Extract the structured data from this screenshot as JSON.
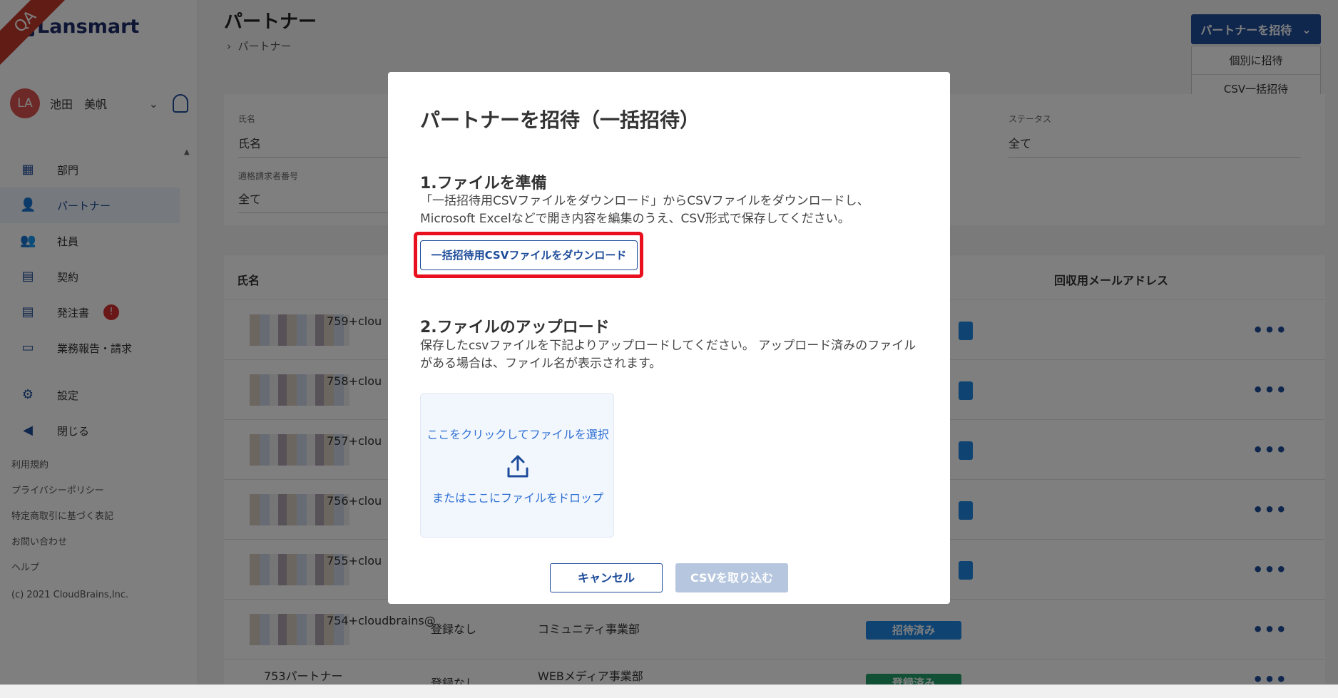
{
  "app": {
    "logo_text": "Lansmart",
    "qa_ribbon": "QA"
  },
  "user": {
    "initials": "LA",
    "name": "池田　美帆"
  },
  "sidebar": {
    "items": [
      {
        "label": "部門",
        "icon": "building-icon"
      },
      {
        "label": "パートナー",
        "icon": "person-icon"
      },
      {
        "label": "社員",
        "icon": "people-icon"
      },
      {
        "label": "契約",
        "icon": "document-icon"
      },
      {
        "label": "発注書",
        "icon": "document-icon",
        "badge": "!"
      },
      {
        "label": "業務報告・請求",
        "icon": "folder-icon"
      },
      {
        "label": "設定",
        "icon": "gear-icon"
      },
      {
        "label": "閉じる",
        "icon": "collapse-icon"
      }
    ],
    "footer_links": [
      "利用規約",
      "プライバシーポリシー",
      "特定商取引に基づく表記",
      "お問い合わせ",
      "ヘルプ"
    ],
    "copyright": "(c) 2021 CloudBrains,Inc."
  },
  "header": {
    "title": "パートナー",
    "breadcrumb": "パートナー",
    "invite_button": "パートナーを招待",
    "invite_menu": [
      "個別に招待",
      "CSV一括招待"
    ]
  },
  "filters": {
    "name_label": "氏名",
    "name_placeholder": "氏名",
    "invoice_label": "適格請求者番号",
    "invoice_value": "全て",
    "status_label": "ステータス",
    "status_value": "全て"
  },
  "table": {
    "headers": {
      "name": "氏名",
      "recovery_email": "回収用メールアドレス"
    },
    "rows": [
      {
        "email": "759+clou",
        "status": "",
        "dept": "",
        "phone": ""
      },
      {
        "email": "758+clou",
        "status": "",
        "dept": "",
        "phone": ""
      },
      {
        "email": "757+clou",
        "status": "",
        "dept": "",
        "phone": ""
      },
      {
        "email": "756+clou",
        "status": "",
        "dept": "",
        "phone": ""
      },
      {
        "email": "755+clou",
        "status": "",
        "dept": "",
        "phone": ""
      },
      {
        "email": "754+cloudbrains@",
        "phone": "登録なし",
        "dept": "コミュニティ事業部",
        "status": "招待済み"
      },
      {
        "email": "753パートナー",
        "phone": "登録なし",
        "dept": "WEBメディア事業部",
        "status": "登録済み"
      }
    ]
  },
  "modal": {
    "title": "パートナーを招待（一括招待）",
    "step1_title": "1.ファイルを準備",
    "step1_desc": "「一括招待用CSVファイルをダウンロード」からCSVファイルをダウンロードし、Microsoft Excelなどで開き内容を編集のうえ、CSV形式で保存してください。",
    "download_button": "一括招待用CSVファイルをダウンロード",
    "step2_title": "2.ファイルのアップロード",
    "step2_desc": "保存したcsvファイルを下記よりアップロードしてください。 アップロード済みのファイルがある場合は、ファイル名が表示されます。",
    "dropzone_click": "ここをクリックしてファイルを選択",
    "dropzone_drop": "またはここにファイルをドロップ",
    "cancel_button": "キャンセル",
    "import_button": "CSVを取り込む"
  },
  "colors": {
    "primary": "#1e4c9a",
    "highlight": "#e8101e",
    "invited": "#1e88e5",
    "registered": "#22a06b"
  }
}
